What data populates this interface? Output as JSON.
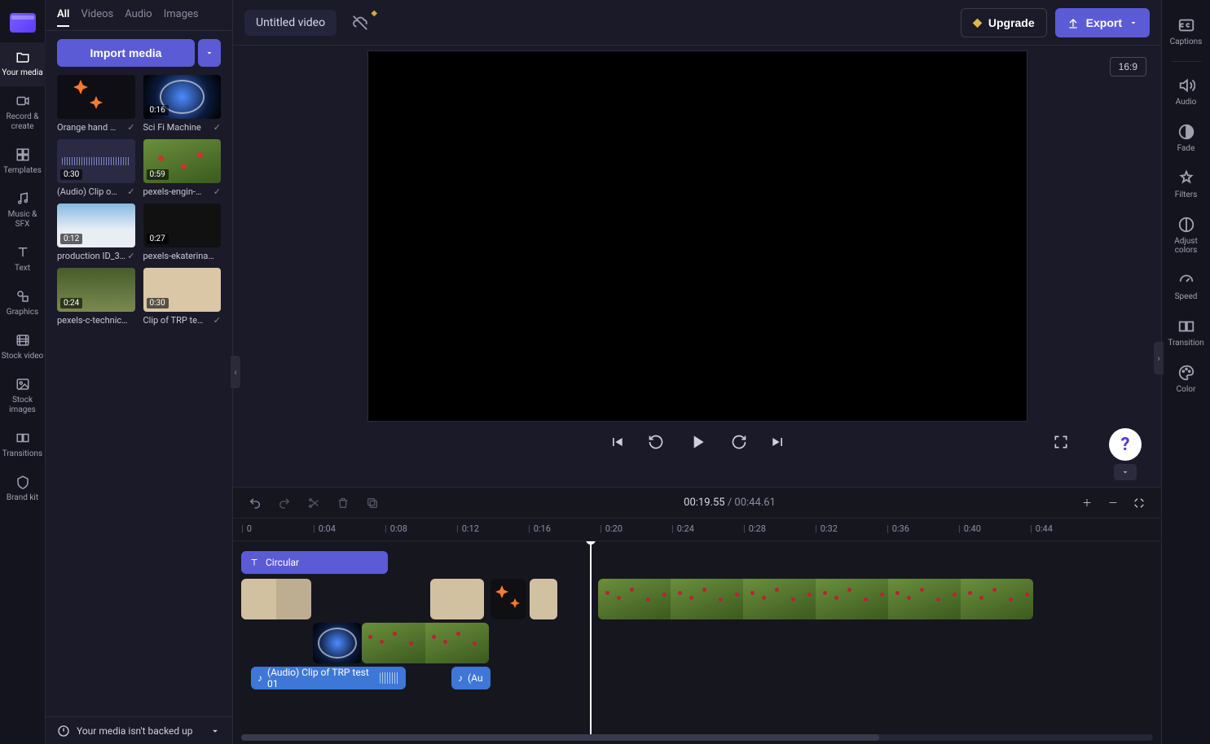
{
  "header": {
    "video_title": "Untitled video",
    "upgrade_label": "Upgrade",
    "export_label": "Export",
    "aspect_ratio": "16:9"
  },
  "sidebar_left": {
    "items": [
      {
        "label": "Your media",
        "icon": "folder-icon"
      },
      {
        "label": "Record & create",
        "icon": "camera-icon"
      },
      {
        "label": "Templates",
        "icon": "templates-icon"
      },
      {
        "label": "Music & SFX",
        "icon": "music-icon"
      },
      {
        "label": "Text",
        "icon": "text-icon"
      },
      {
        "label": "Graphics",
        "icon": "shapes-icon"
      },
      {
        "label": "Stock video",
        "icon": "film-icon"
      },
      {
        "label": "Stock images",
        "icon": "image-icon"
      },
      {
        "label": "Transitions",
        "icon": "transitions-icon"
      },
      {
        "label": "Brand kit",
        "icon": "brandkit-icon"
      }
    ]
  },
  "media_tabs": {
    "all": "All",
    "videos": "Videos",
    "audio": "Audio",
    "images": "Images",
    "import": "Import media"
  },
  "media": [
    {
      "name": "Orange hand …",
      "duration": "",
      "thumb": "orange"
    },
    {
      "name": "Sci Fi Machine",
      "duration": "0:16",
      "thumb": "scifi"
    },
    {
      "name": "(Audio) Clip o…",
      "duration": "0:30",
      "thumb": "wave"
    },
    {
      "name": "pexels-engin-…",
      "duration": "0:59",
      "thumb": "flower"
    },
    {
      "name": "production ID_3…",
      "duration": "0:12",
      "thumb": "snow"
    },
    {
      "name": "pexels-ekaterina…",
      "duration": "0:27",
      "thumb": "room"
    },
    {
      "name": "pexels-c-technic…",
      "duration": "0:24",
      "thumb": "grass"
    },
    {
      "name": "Clip of TRP te…",
      "duration": "0:30",
      "thumb": "team"
    }
  ],
  "transport": {
    "current": "00:19",
    "current_frac": ".55",
    "total": "00:44",
    "total_frac": ".61"
  },
  "ruler": [
    "0",
    "0:04",
    "0:08",
    "0:12",
    "0:16",
    "0:20",
    "0:24",
    "0:28",
    "0:32",
    "0:36",
    "0:40",
    "0:44"
  ],
  "tracks": {
    "text_clip": {
      "label": "Circular"
    },
    "audio1": {
      "label": "(Audio) Clip of TRP test 01"
    },
    "audio2": {
      "label": "(Au"
    }
  },
  "right_rail": {
    "items": [
      {
        "label": "Captions",
        "icon": "captions-icon"
      },
      {
        "label": "Audio",
        "icon": "audio-icon"
      },
      {
        "label": "Fade",
        "icon": "fade-icon"
      },
      {
        "label": "Filters",
        "icon": "filters-icon"
      },
      {
        "label": "Adjust colors",
        "icon": "adjust-icon"
      },
      {
        "label": "Speed",
        "icon": "speed-icon"
      },
      {
        "label": "Transition",
        "icon": "transition-icon"
      },
      {
        "label": "Color",
        "icon": "color-icon"
      }
    ]
  },
  "footer": {
    "backup": "Your media isn't backed up"
  }
}
